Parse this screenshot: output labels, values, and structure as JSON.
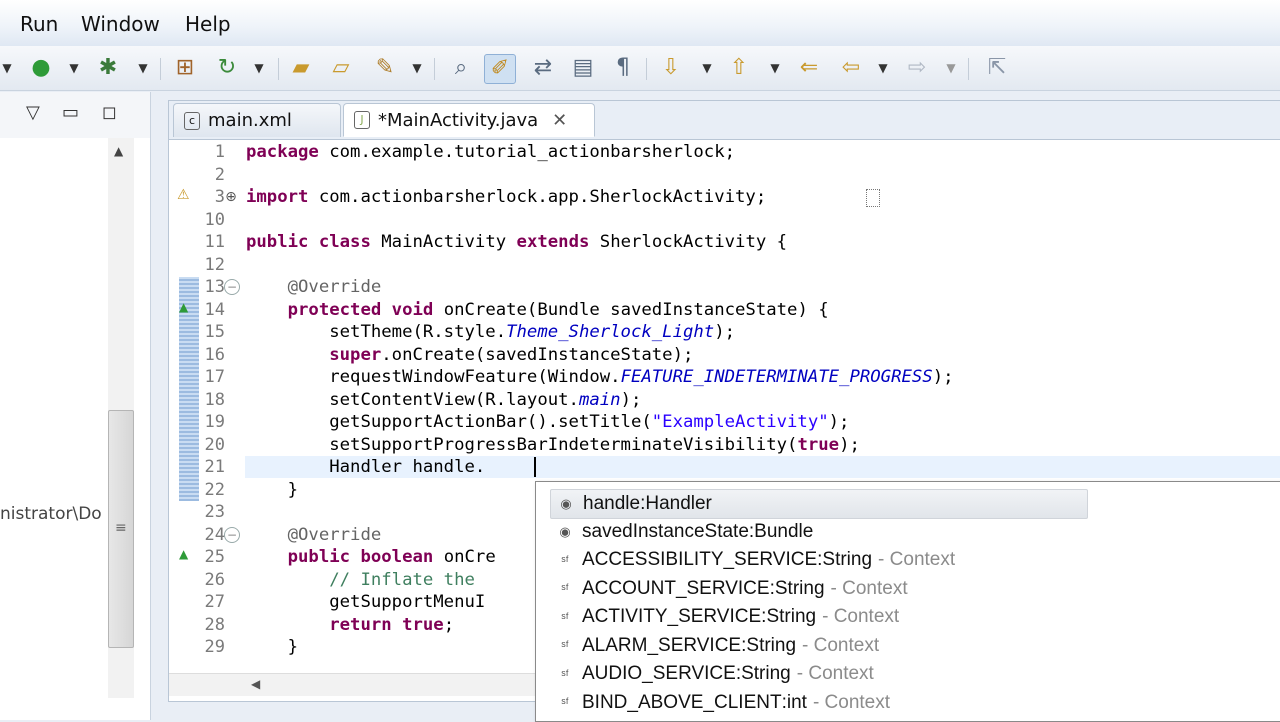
{
  "menu": {
    "items": [
      "Run",
      "Window",
      "Help"
    ]
  },
  "toolbar": {
    "icons": [
      "run-icon",
      "debug-icon",
      "dropdown-icon",
      "new-package-icon",
      "refresh-icon",
      "dropdown-icon",
      "open-folder-icon",
      "open-file-icon",
      "wrench-icon",
      "dropdown-icon",
      "search-icon",
      "mark-occurrences-icon",
      "link-icon",
      "block-selection-icon",
      "show-whitespace-icon",
      "next-annotation-icon",
      "dropdown-icon",
      "previous-annotation-icon",
      "dropdown-icon",
      "last-edit-icon",
      "back-icon",
      "dropdown-icon",
      "forward-icon",
      "dropdown-icon",
      "pin-icon"
    ]
  },
  "left_panel": {
    "path_text": "nistrator\\Do"
  },
  "tabs": [
    {
      "label": "main.xml",
      "active": false
    },
    {
      "label": "*MainActivity.java",
      "active": true
    }
  ],
  "lines": [
    {
      "num": "1",
      "text": "package com.example.tutorial_actionbarsherlock;"
    },
    {
      "num": "2",
      "text": ""
    },
    {
      "num": "3",
      "text": "import com.actionbarsherlock.app.SherlockActivity;"
    },
    {
      "num": "10",
      "text": ""
    },
    {
      "num": "11",
      "text": "public class MainActivity extends SherlockActivity {"
    },
    {
      "num": "12",
      "text": ""
    },
    {
      "num": "13",
      "text": "    @Override"
    },
    {
      "num": "14",
      "text": "    protected void onCreate(Bundle savedInstanceState) {"
    },
    {
      "num": "15",
      "text": "        setTheme(R.style.Theme_Sherlock_Light);"
    },
    {
      "num": "16",
      "text": "        super.onCreate(savedInstanceState);"
    },
    {
      "num": "17",
      "text": "        requestWindowFeature(Window.FEATURE_INDETERMINATE_PROGRESS);"
    },
    {
      "num": "18",
      "text": "        setContentView(R.layout.main);"
    },
    {
      "num": "19",
      "text": "        getSupportActionBar().setTitle(\"ExampleActivity\");"
    },
    {
      "num": "20",
      "text": "        setSupportProgressBarIndeterminateVisibility(true);"
    },
    {
      "num": "21",
      "text": "        Handler handle."
    },
    {
      "num": "22",
      "text": "    }"
    },
    {
      "num": "23",
      "text": ""
    },
    {
      "num": "24",
      "text": "    @Override"
    },
    {
      "num": "25",
      "text": "    public boolean onCre"
    },
    {
      "num": "26",
      "text": "        // Inflate the"
    },
    {
      "num": "27",
      "text": "        getSupportMenuI"
    },
    {
      "num": "28",
      "text": "        return true;"
    },
    {
      "num": "29",
      "text": "    }"
    }
  ],
  "content_assist": {
    "proposals": [
      {
        "name": "handle",
        "type": "Handler",
        "context": "",
        "icon": "local-variable-icon",
        "selected": true
      },
      {
        "name": "savedInstanceState",
        "type": "Bundle",
        "context": "",
        "icon": "local-variable-icon",
        "selected": false
      },
      {
        "name": "ACCESSIBILITY_SERVICE",
        "type": "String",
        "context": "Context",
        "icon": "static-final-field-icon",
        "selected": false
      },
      {
        "name": "ACCOUNT_SERVICE",
        "type": "String",
        "context": "Context",
        "icon": "static-final-field-icon",
        "selected": false
      },
      {
        "name": "ACTIVITY_SERVICE",
        "type": "String",
        "context": "Context",
        "icon": "static-final-field-icon",
        "selected": false
      },
      {
        "name": "ALARM_SERVICE",
        "type": "String",
        "context": "Context",
        "icon": "static-final-field-icon",
        "selected": false
      },
      {
        "name": "AUDIO_SERVICE",
        "type": "String",
        "context": "Context",
        "icon": "static-final-field-icon",
        "selected": false
      },
      {
        "name": "BIND_ABOVE_CLIENT",
        "type": "int",
        "context": "Context",
        "icon": "static-final-field-icon",
        "selected": false
      }
    ]
  },
  "colors": {
    "keyword": "#7f0055",
    "annotation": "#646464",
    "static_field": "#0000c0",
    "string": "#2a00ff",
    "comment": "#3f7f5f",
    "current_line": "#e8f2fe"
  }
}
